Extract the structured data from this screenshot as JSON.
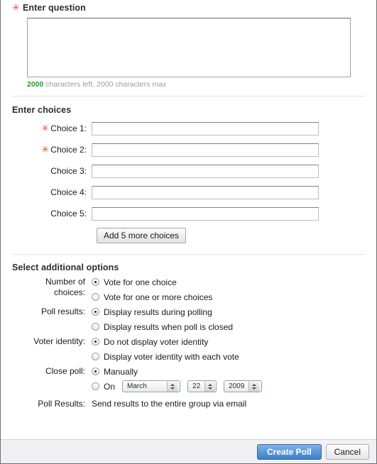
{
  "question_section": {
    "heading": "Enter question",
    "required_marker": "✳",
    "textarea_value": "",
    "textarea_placeholder": "",
    "chars_left": "2000",
    "chars_text": " characters left, 2000 characters max"
  },
  "choices_section": {
    "heading": "Enter choices",
    "items": [
      {
        "label": "Choice 1:",
        "required": true,
        "value": ""
      },
      {
        "label": "Choice 2:",
        "required": true,
        "value": ""
      },
      {
        "label": "Choice 3:",
        "required": false,
        "value": ""
      },
      {
        "label": "Choice 4:",
        "required": false,
        "value": ""
      },
      {
        "label": "Choice 5:",
        "required": false,
        "value": ""
      }
    ],
    "add_button": "Add 5 more choices"
  },
  "options_section": {
    "heading": "Select additional options",
    "groups": [
      {
        "label": "Number of choices:",
        "options": [
          {
            "text": "Vote for one choice",
            "selected": true
          },
          {
            "text": "Vote for one or more choices",
            "selected": false
          }
        ]
      },
      {
        "label": "Poll results:",
        "options": [
          {
            "text": "Display results during polling",
            "selected": true
          },
          {
            "text": "Display results when poll is closed",
            "selected": false
          }
        ]
      },
      {
        "label": "Voter identity:",
        "options": [
          {
            "text": "Do not display voter identity",
            "selected": true
          },
          {
            "text": "Display voter identity with each vote",
            "selected": false
          }
        ]
      }
    ],
    "close_poll": {
      "label": "Close poll:",
      "manual_option": {
        "text": "Manually",
        "selected": true
      },
      "on_option": {
        "text": "On",
        "selected": false
      },
      "month": "March",
      "day": "22",
      "year": "2009"
    },
    "poll_results_row": {
      "label": "Poll Results:",
      "value": "Send results to the entire group via email"
    }
  },
  "footer": {
    "submit_label": "Create Poll",
    "cancel_label": "Cancel"
  },
  "colors": {
    "required_marker": "#e0502a",
    "chars_left": "#1a9d28",
    "primary_button": "#3c7fc6"
  }
}
